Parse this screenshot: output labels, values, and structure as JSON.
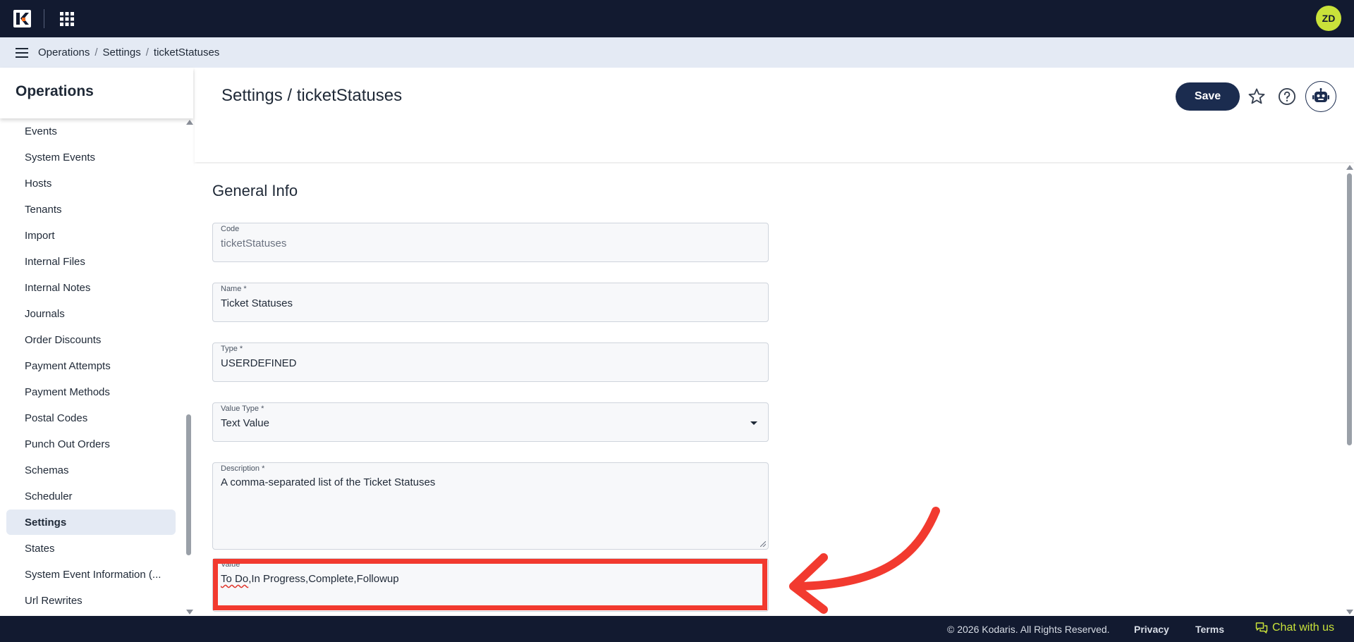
{
  "topbar": {
    "avatar_initials": "ZD",
    "logo_icon": "kodaris-logo",
    "apps_icon": "grid-icon",
    "bg_color": "#121a30",
    "accent_color": "#c9e23a"
  },
  "breadcrumb": {
    "items": [
      "Operations",
      "Settings",
      "ticketStatuses"
    ],
    "separator": "/"
  },
  "sidebar": {
    "title": "Operations",
    "items": [
      {
        "label": "Events",
        "active": false
      },
      {
        "label": "System Events",
        "active": false
      },
      {
        "label": "Hosts",
        "active": false
      },
      {
        "label": "Tenants",
        "active": false
      },
      {
        "label": "Import",
        "active": false
      },
      {
        "label": "Internal Files",
        "active": false
      },
      {
        "label": "Internal Notes",
        "active": false
      },
      {
        "label": "Journals",
        "active": false
      },
      {
        "label": "Order Discounts",
        "active": false
      },
      {
        "label": "Payment Attempts",
        "active": false
      },
      {
        "label": "Payment Methods",
        "active": false
      },
      {
        "label": "Postal Codes",
        "active": false
      },
      {
        "label": "Punch Out Orders",
        "active": false
      },
      {
        "label": "Schemas",
        "active": false
      },
      {
        "label": "Scheduler",
        "active": false
      },
      {
        "label": "Settings",
        "active": true
      },
      {
        "label": "States",
        "active": false
      },
      {
        "label": "System Event Information (...",
        "active": false
      },
      {
        "label": "Url Rewrites",
        "active": false
      }
    ]
  },
  "header": {
    "title": "Settings / ticketStatuses",
    "save_label": "Save"
  },
  "form": {
    "section_title": "General Info",
    "code": {
      "label": "Code",
      "value": "ticketStatuses"
    },
    "name": {
      "label": "Name *",
      "value": "Ticket Statuses"
    },
    "type": {
      "label": "Type *",
      "value": "USERDEFINED"
    },
    "value_type": {
      "label": "Value Type *",
      "value": "Text Value"
    },
    "description": {
      "label": "Description *",
      "value": "A comma-separated list of the Ticket Statuses"
    },
    "value": {
      "label": "Value",
      "value_first": "To Do",
      "value_rest": ",In Progress,Complete,Followup"
    }
  },
  "annotation": {
    "color": "#f23a2f"
  },
  "footer": {
    "copyright": "© 2026 Kodaris. All Rights Reserved.",
    "privacy": "Privacy",
    "terms": "Terms",
    "chat": "Chat with us"
  }
}
